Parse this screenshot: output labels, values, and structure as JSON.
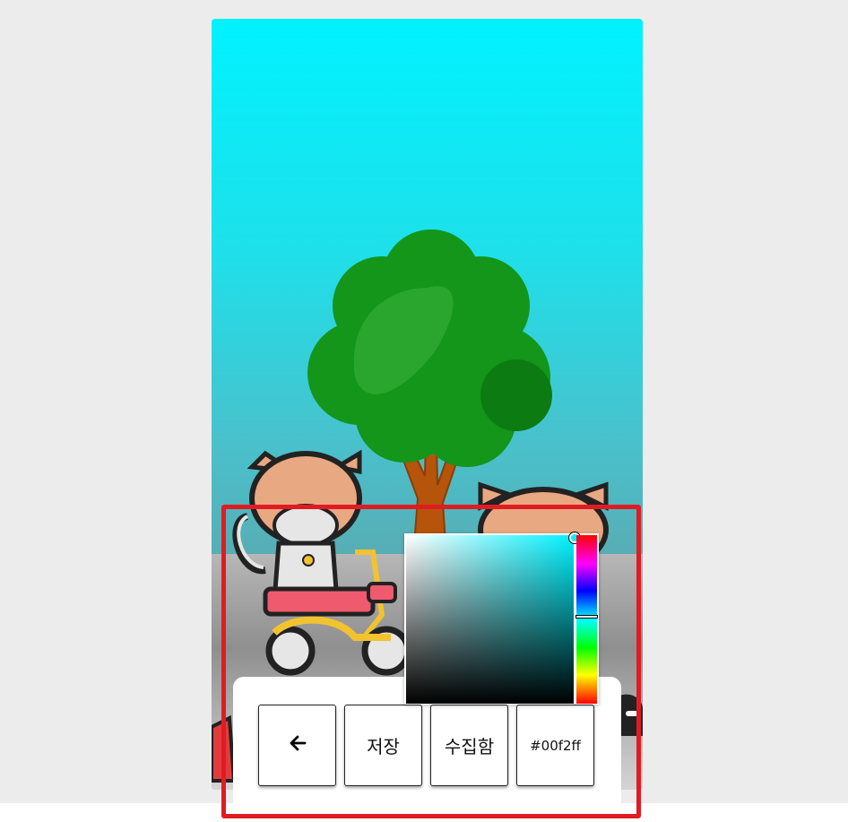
{
  "toolbar": {
    "back_icon": "arrow-left-icon",
    "save_label": "저장",
    "collection_label": "수집함",
    "color_hex_label": "#00f2ff"
  },
  "color_picker": {
    "current_color": "#00f2ff"
  },
  "colors": {
    "background_top": "#00f2ff",
    "highlight": "#e11b22",
    "tree_foliage": "#13961a",
    "tree_trunk": "#b5540a",
    "cat_fur": "#e8a882",
    "scooter": "#f05a6e"
  }
}
